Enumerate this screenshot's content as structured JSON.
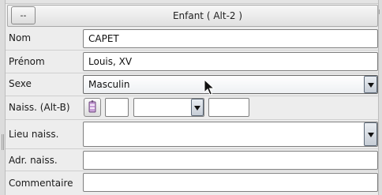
{
  "header": {
    "button_label": "--",
    "title": "Enfant   ( Alt-2 )"
  },
  "form": {
    "nom": {
      "label": "Nom",
      "value": "CAPET"
    },
    "prenom": {
      "label": "Prénom",
      "value": "Louis, XV"
    },
    "sexe": {
      "label": "Sexe",
      "selected": "Masculin"
    },
    "naissance": {
      "label": "Naiss. (Alt-B)",
      "day": "",
      "month": "",
      "year": ""
    },
    "lieu_naissance": {
      "label": "Lieu naiss.",
      "value": ""
    },
    "adresse_naissance": {
      "label": "Adr. naiss.",
      "value": ""
    },
    "commentaire": {
      "label": "Commentaire",
      "value": ""
    }
  },
  "icons": {
    "calendar_button": "calendar-icon",
    "dropdown": "chevron-down-icon",
    "cursor": "mouse-pointer-icon"
  }
}
